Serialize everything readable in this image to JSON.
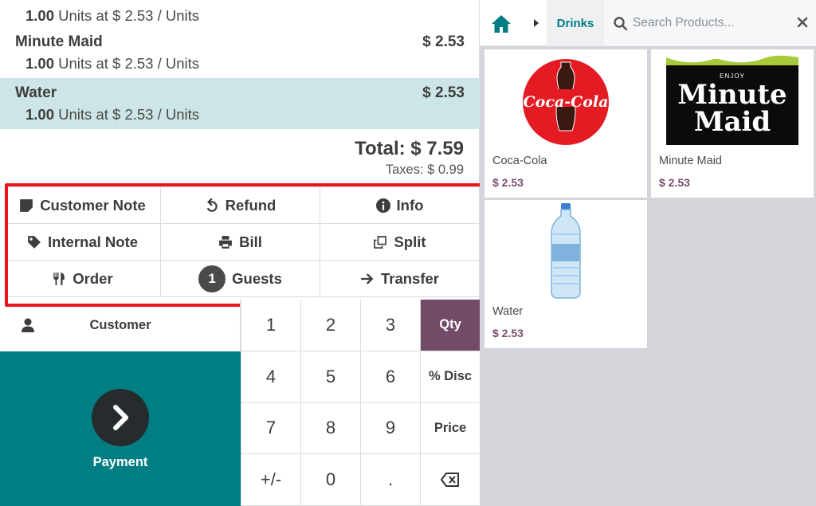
{
  "order": {
    "lines": [
      {
        "name": "",
        "qty": "1.00",
        "detail": " Units at $ 2.53 / Units",
        "price": ""
      },
      {
        "name": "Minute Maid",
        "qty": "1.00",
        "detail": " Units at $ 2.53 / Units",
        "price": "$ 2.53"
      },
      {
        "name": "Water",
        "qty": "1.00",
        "detail": " Units at $ 2.53 / Units",
        "price": "$ 2.53",
        "selected": true
      }
    ],
    "total": "Total: $ 7.59",
    "taxes": "Taxes: $ 0.99"
  },
  "controls": {
    "customer_note": "Customer Note",
    "refund": "Refund",
    "info": "Info",
    "internal_note": "Internal Note",
    "bill": "Bill",
    "split": "Split",
    "order": "Order",
    "guests_count": "1",
    "guests": "Guests",
    "transfer": "Transfer"
  },
  "customer_label": "Customer",
  "payment_label": "Payment",
  "numpad": {
    "k1": "1",
    "k2": "2",
    "k3": "3",
    "qty": "Qty",
    "k4": "4",
    "k5": "5",
    "k6": "6",
    "disc": "% Disc",
    "k7": "7",
    "k8": "8",
    "k9": "9",
    "price": "Price",
    "plusminus": "+/-",
    "k0": "0",
    "dot": "."
  },
  "products_pane": {
    "breadcrumb": "Drinks",
    "search_placeholder": "Search Products..."
  },
  "products": [
    {
      "name": "Coca-Cola",
      "price": "$ 2.53",
      "logo_text": "Coca-Cola"
    },
    {
      "name": "Minute Maid",
      "price": "$ 2.53",
      "logo_top": "ENJOY",
      "logo_line1": "Minute",
      "logo_line2": "Maid"
    },
    {
      "name": "Water",
      "price": "$ 2.53"
    }
  ],
  "colors": {
    "teal": "#017e84",
    "selected_line": "#cde5e6",
    "qty_active": "#714b67",
    "highlight": "#e8161b",
    "product_price": "#7a4b6e"
  }
}
